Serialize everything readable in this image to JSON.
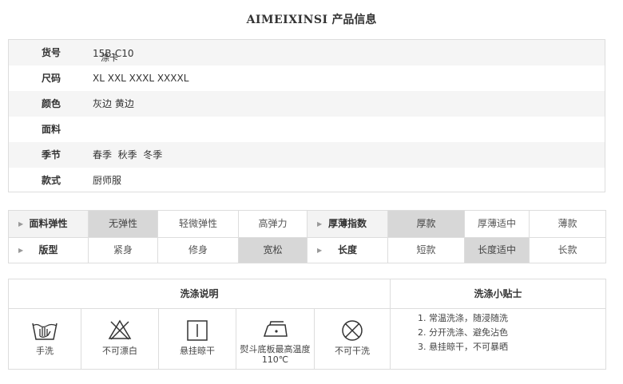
{
  "title": {
    "brand": "AIMEIXINSI",
    "suffix": "产品信息"
  },
  "info": {
    "rows": [
      {
        "label": "货号",
        "value": "15B-C10",
        "sub": "涤卡"
      },
      {
        "label": "尺码",
        "value": "XL XXL XXXL XXXXL"
      },
      {
        "label": "颜色",
        "value": "灰边 黄边"
      },
      {
        "label": "面料",
        "value": ""
      },
      {
        "label": "季节",
        "value": "春季  秋季  冬季"
      },
      {
        "label": "款式",
        "value": "厨师服"
      }
    ]
  },
  "attributes": {
    "row1": {
      "elastic_label": "面料弹性",
      "elastic_options": [
        "无弹性",
        "轻微弹性",
        "高弹力"
      ],
      "elastic_selected": "无弹性",
      "thickness_label": "厚薄指数",
      "thickness_options": [
        "厚款",
        "厚薄适中",
        "薄款"
      ],
      "thickness_selected": "厚款"
    },
    "row2": {
      "fit_label": "版型",
      "fit_options": [
        "紧身",
        "修身",
        "宽松"
      ],
      "fit_selected": "宽松",
      "length_label": "长度",
      "length_options": [
        "短款",
        "长度适中",
        "长款"
      ],
      "length_selected": "长度适中"
    }
  },
  "washing": {
    "header": "洗涤说明",
    "icons": [
      {
        "icon": "hand-wash-icon",
        "caption": "手洗"
      },
      {
        "icon": "no-bleach-icon",
        "caption": "不可漂白"
      },
      {
        "icon": "hang-dry-icon",
        "caption": "悬挂晾干"
      },
      {
        "icon": "iron-icon",
        "caption": "熨斗底板最高温度110℃"
      },
      {
        "icon": "no-dry-clean-icon",
        "caption": "不可干洗"
      }
    ]
  },
  "tips": {
    "header": "洗涤小贴士",
    "items": [
      "1. 常温洗涤，随浸随洗",
      "2. 分开洗涤、避免沾色",
      "3. 悬挂晾干，不可暴晒"
    ]
  }
}
